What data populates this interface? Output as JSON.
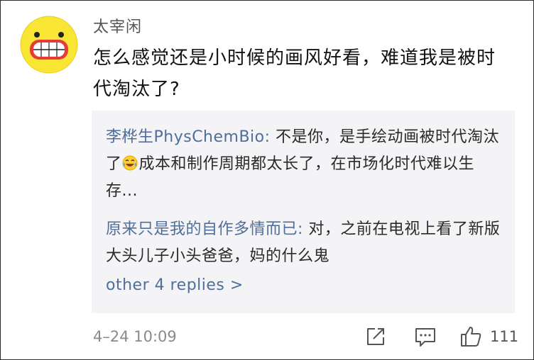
{
  "comment": {
    "username": "太宰闲",
    "text": "怎么感觉还是小时候的画风好看，难道我是被时代淘汰了?",
    "timestamp": "4–24 10:09",
    "like_count": "111"
  },
  "replies": [
    {
      "author": "李桦生PhysChemBio:",
      "text_before_emoji": " 不是你，是手绘动画被时代淘汰了",
      "emoji": "laughing-crying-emoji",
      "text_after_emoji": "成本和制作周期都太长了，在市场化时代难以生存..."
    },
    {
      "author": "原来只是我的自作多情而已:",
      "text": " 对，之前在电视上看了新版大头儿子小头爸爸，妈的什么鬼"
    }
  ],
  "more_replies_label": "other 4 replies >",
  "icons": {
    "avatar": "yellow-cartoon-face-avatar",
    "share": "share-icon",
    "comment": "comment-icon",
    "like": "thumbs-up-icon"
  }
}
